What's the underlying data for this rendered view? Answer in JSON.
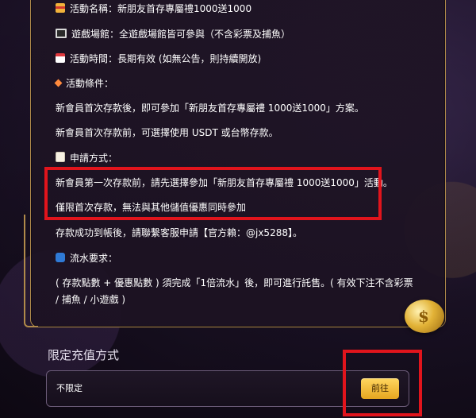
{
  "details": {
    "name_line": "活動名稱：新朋友首存專屬禮1000送1000",
    "venue_line": "遊戲場館：全遊戲場館皆可參與（不含彩票及捕魚）",
    "time_line": "活動時間：長期有效 (如無公告，則持續開放)",
    "conditions_heading": "活動條件：",
    "condition_1": "新會員首次存款後，即可參加「新朋友首存專屬禮 1000送1000」方案。",
    "condition_2": "新會員首次存款前，可選擇使用 USDT 或台幣存款。",
    "apply_heading": "申請方式：",
    "apply_1": "新會員第一次存款前，請先選擇參加「新朋友首存專屬禮 1000送1000」活動。",
    "apply_2": "僅限首次存款，無法與其他儲值優惠同時參加",
    "apply_3": "存款成功到帳後，請聯繫客服申請【官方賴：@jx5288】。",
    "turnover_heading": "流水要求：",
    "turnover_1": "( 存款點數 + 優惠點數 ) 須完成「1倍流水」後，即可進行託售。( 有效下注不含彩票",
    "turnover_2": "/ 捕魚 / 小遊戲 )"
  },
  "recharge": {
    "title": "限定充值方式",
    "value": "不限定",
    "button": "前往"
  },
  "icons": {
    "name": "gift-icon",
    "venue": "monitor-icon",
    "time": "calendar-icon",
    "conditions": "diamond-icon",
    "apply": "memo-icon",
    "turnover": "cycle-icon",
    "coin": "coin-icon"
  },
  "colors": {
    "accent_gold": "#e6a51f",
    "highlight_red": "#e1141c",
    "panel_border": "#b08a4a"
  }
}
